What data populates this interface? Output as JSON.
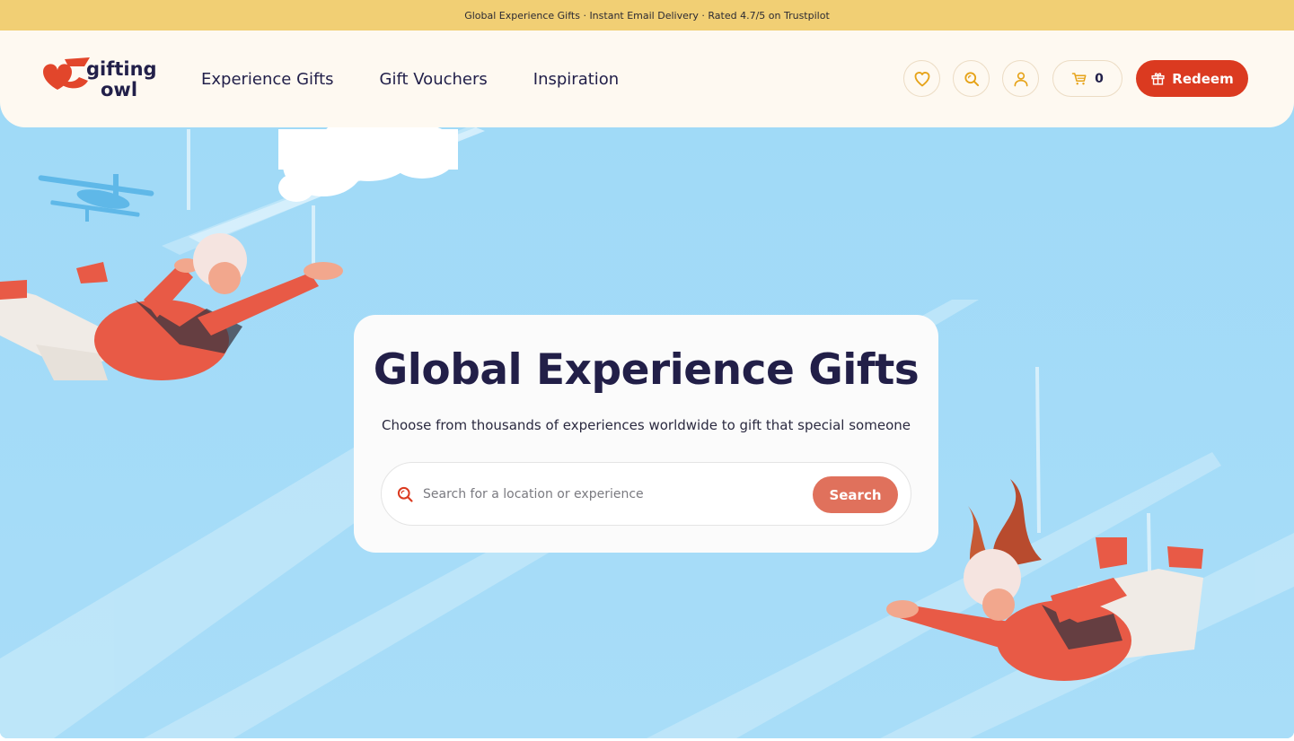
{
  "announcement": "Global Experience Gifts · Instant Email Delivery · Rated 4.7/5 on Trustpilot",
  "logo": {
    "line1": "gifting",
    "line2": "owl"
  },
  "nav": [
    {
      "label": "Experience Gifts"
    },
    {
      "label": "Gift Vouchers"
    },
    {
      "label": "Inspiration"
    }
  ],
  "header_actions": {
    "wishlist_icon": "heart-icon",
    "search_icon": "search-icon",
    "account_icon": "user-icon",
    "cart_icon": "cart-icon",
    "cart_count": "0",
    "redeem_label": "Redeem",
    "redeem_icon": "gift-icon"
  },
  "hero": {
    "title": "Global Experience Gifts",
    "subtitle": "Choose from thousands of experiences worldwide to gift that special someone",
    "search_placeholder": "Search for a location or experience",
    "search_button": "Search"
  },
  "colors": {
    "announcement_bg": "#f1cf74",
    "header_bg": "#fef9f1",
    "sky": "#a2dbf7",
    "brand_red": "#db3a20",
    "search_button": "#e0715c",
    "title": "#221f48"
  }
}
